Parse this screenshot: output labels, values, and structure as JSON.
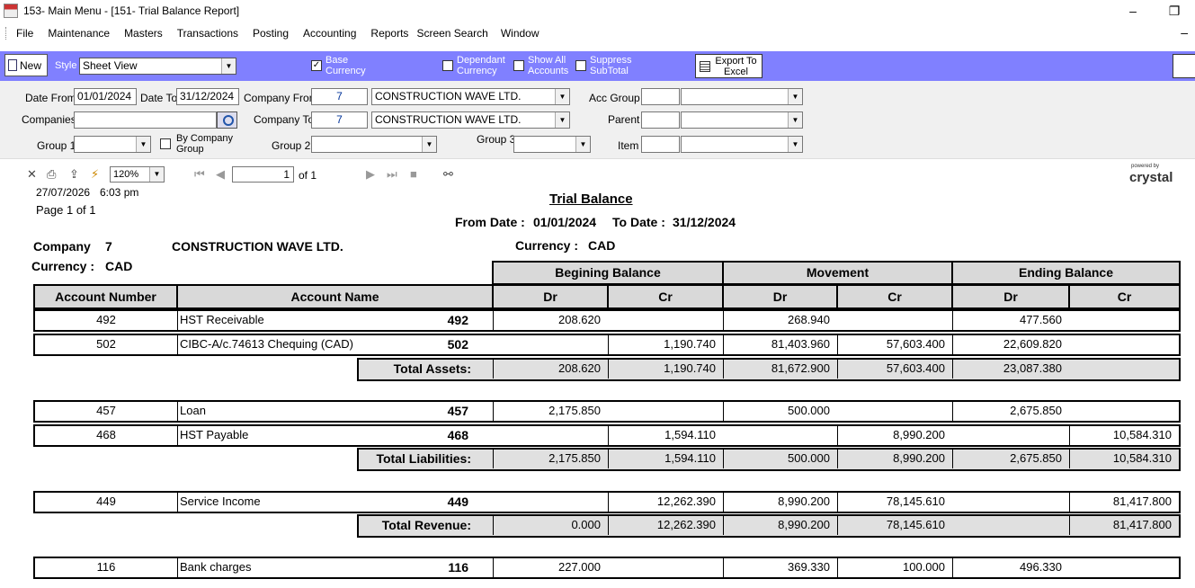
{
  "window": {
    "title": "153- Main Menu - [151- Trial Balance Report]",
    "minimize": "–",
    "restore": "❐"
  },
  "menu": [
    "File",
    "Maintenance",
    "Masters",
    "Transactions",
    "Posting",
    "Accounting",
    "Reports",
    "Screen Search",
    "Window"
  ],
  "toolbar": {
    "new_label": "New",
    "style_label": "Style",
    "style_value": "Sheet View",
    "base_currency": {
      "line1": "Base",
      "line2": "Currency",
      "checked": true
    },
    "dependant_currency": {
      "line1": "Dependant",
      "line2": "Currency",
      "checked": false
    },
    "show_all_accounts": {
      "line1": "Show All",
      "line2": "Accounts",
      "checked": false
    },
    "suppress_subtotal": {
      "line1": "Suppress",
      "line2": "SubTotal",
      "checked": false
    },
    "export_line1": "Export To",
    "export_line2": "Excel"
  },
  "filters": {
    "date_from_label": "Date From",
    "date_from": "01/01/2024",
    "date_to_label": "Date To",
    "date_to": "31/12/2024",
    "company_from_label": "Company From",
    "company_from_code": "7",
    "company_from_name": "CONSTRUCTION WAVE LTD.",
    "company_to_label": "Company To",
    "company_to_code": "7",
    "company_to_name": "CONSTRUCTION WAVE LTD.",
    "companies_label": "Companies",
    "acc_group_label": "Acc Group",
    "parent_label": "Parent",
    "group1_label": "Group 1",
    "by_company_group_line1": "By Company",
    "by_company_group_line2": "Group",
    "group2_label": "Group 2",
    "group3_label": "Group 3",
    "item_label": "Item"
  },
  "viewer": {
    "zoom": "120%",
    "page": "1",
    "of_label": "of 1",
    "powered_by": "powered by",
    "brand": "crystal"
  },
  "report": {
    "print_date": "27/07/2026",
    "print_time": "6:03 pm",
    "page_info": "Page 1 of 1",
    "title": "Trial Balance",
    "from_date_label": "From Date :",
    "from_date": "01/01/2024",
    "to_date_label": "To Date :",
    "to_date": "31/12/2024",
    "company_label": "Company",
    "company_code": "7",
    "company_name": "CONSTRUCTION WAVE LTD.",
    "currency_label": "Currency :",
    "currency": "CAD",
    "currency2_label": "Currency :",
    "currency2": "CAD",
    "headers": {
      "begining_balance": "Begining Balance",
      "movement": "Movement",
      "ending_balance": "Ending Balance",
      "account_number": "Account Number",
      "account_name": "Account Name",
      "dr": "Dr",
      "cr": "Cr"
    },
    "rows": [
      {
        "acc": "492",
        "name": "HST Receivable",
        "code": "492",
        "bdr": "208.620",
        "bcr": "",
        "mdr": "268.940",
        "mcr": "",
        "edr": "477.560",
        "ecr": ""
      },
      {
        "acc": "502",
        "name": "CIBC-A/c.74613 Chequing (CAD)",
        "code": "502",
        "bdr": "",
        "bcr": "1,190.740",
        "mdr": "81,403.960",
        "mcr": "57,603.400",
        "edr": "22,609.820",
        "ecr": ""
      },
      {
        "acc": "457",
        "name": "Loan",
        "code": "457",
        "bdr": "2,175.850",
        "bcr": "",
        "mdr": "500.000",
        "mcr": "",
        "edr": "2,675.850",
        "ecr": ""
      },
      {
        "acc": "468",
        "name": "HST Payable",
        "code": "468",
        "bdr": "",
        "bcr": "1,594.110",
        "mdr": "",
        "mcr": "8,990.200",
        "edr": "",
        "ecr": "10,584.310"
      },
      {
        "acc": "449",
        "name": "Service Income",
        "code": "449",
        "bdr": "",
        "bcr": "12,262.390",
        "mdr": "8,990.200",
        "mcr": "78,145.610",
        "edr": "",
        "ecr": "81,417.800"
      },
      {
        "acc": "116",
        "name": "Bank charges",
        "code": "116",
        "bdr": "227.000",
        "bcr": "",
        "mdr": "369.330",
        "mcr": "100.000",
        "edr": "496.330",
        "ecr": ""
      }
    ],
    "totals": [
      {
        "label": "Total Assets:",
        "bdr": "208.620",
        "bcr": "1,190.740",
        "mdr": "81,672.900",
        "mcr": "57,603.400",
        "edr": "23,087.380",
        "ecr": ""
      },
      {
        "label": "Total Liabilities:",
        "bdr": "2,175.850",
        "bcr": "1,594.110",
        "mdr": "500.000",
        "mcr": "8,990.200",
        "edr": "2,675.850",
        "ecr": "10,584.310"
      },
      {
        "label": "Total Revenue:",
        "bdr": "0.000",
        "bcr": "12,262.390",
        "mdr": "8,990.200",
        "mcr": "78,145.610",
        "edr": "",
        "ecr": "81,417.800"
      }
    ]
  }
}
